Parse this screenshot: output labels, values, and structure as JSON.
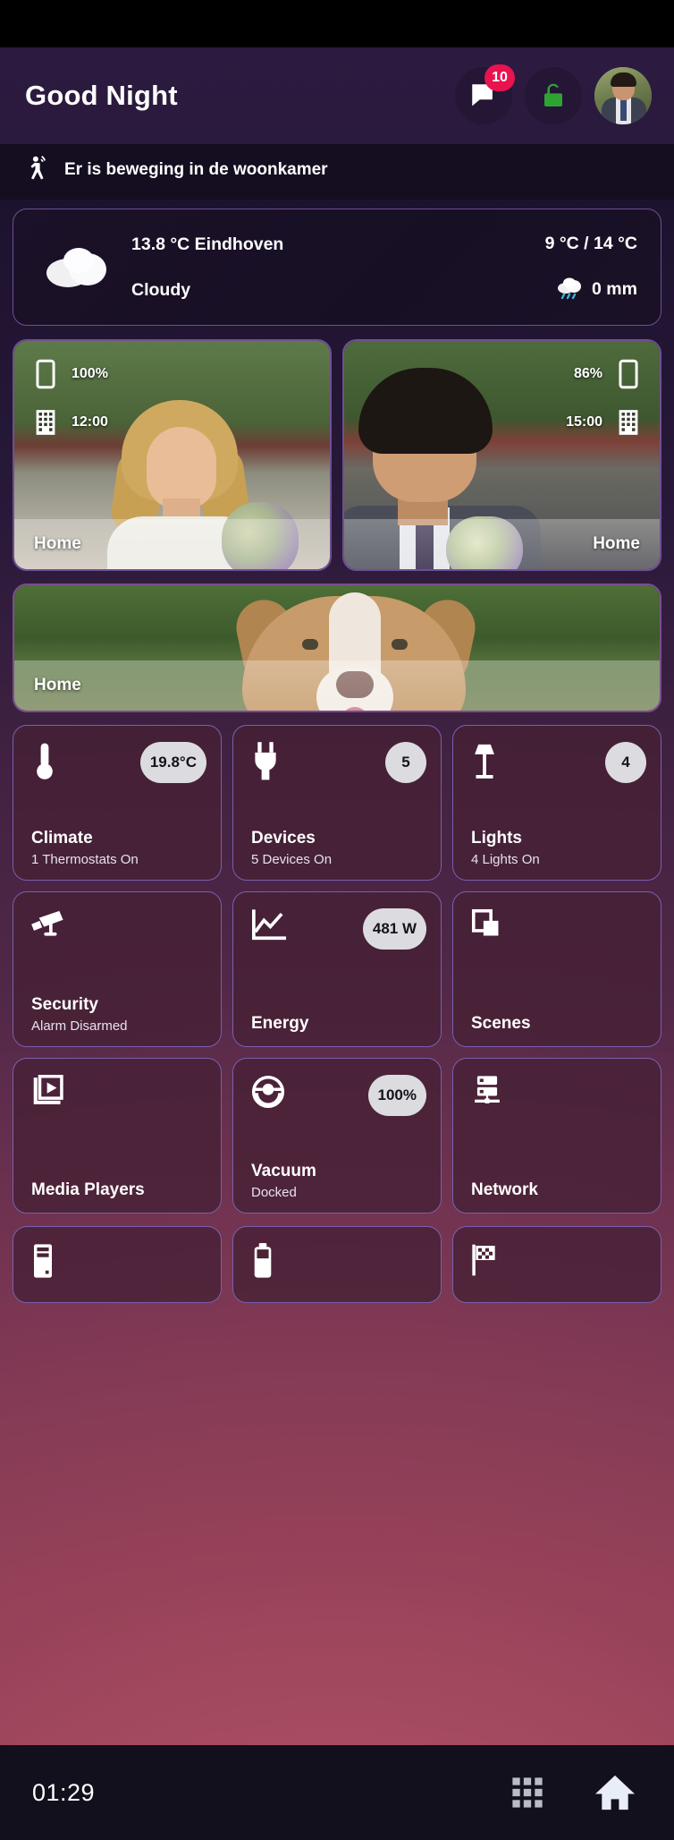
{
  "header": {
    "greeting": "Good Night",
    "notifications_icon": "chat-bubble-icon",
    "notifications_badge": "10",
    "lock_icon": "lock-open-icon",
    "lock_color": "#2ea332",
    "avatar_icon": "user-avatar"
  },
  "notice": {
    "icon": "motion-sensor-icon",
    "text": "Er is beweging in de woonkamer"
  },
  "weather": {
    "icon": "cloudy-icon",
    "temperature_location": "13.8 °C Eindhoven",
    "condition": "Cloudy",
    "range": "9 °C / 14 °C",
    "rain_icon": "rain-cloud-icon",
    "precipitation": "0 mm"
  },
  "people": [
    {
      "name": "Home",
      "battery_icon": "phone-icon",
      "battery": "100%",
      "place_icon": "building-icon",
      "time": "12:00",
      "align": "left"
    },
    {
      "name": "Home",
      "battery_icon": "phone-icon",
      "battery": "86%",
      "place_icon": "building-icon",
      "time": "15:00",
      "align": "right"
    }
  ],
  "pet": {
    "name": "Home"
  },
  "tiles": [
    {
      "icon": "thermometer-icon",
      "pill": "19.8°C",
      "title": "Climate",
      "sub": "1 Thermostats On"
    },
    {
      "icon": "power-plug-icon",
      "pill": "5",
      "title": "Devices",
      "sub": "5 Devices On"
    },
    {
      "icon": "floor-lamp-icon",
      "pill": "4",
      "title": "Lights",
      "sub": "4 Lights On"
    },
    {
      "icon": "cctv-camera-icon",
      "pill": "",
      "title": "Security",
      "sub": "Alarm Disarmed"
    },
    {
      "icon": "line-chart-icon",
      "pill": "481 W",
      "title": "Energy",
      "sub": ""
    },
    {
      "icon": "scenes-layers-icon",
      "pill": "",
      "title": "Scenes",
      "sub": ""
    },
    {
      "icon": "media-player-icon",
      "pill": "",
      "title": "Media Players",
      "sub": ""
    },
    {
      "icon": "robot-vacuum-icon",
      "pill": "100%",
      "title": "Vacuum",
      "sub": "Docked"
    },
    {
      "icon": "server-network-icon",
      "pill": "",
      "title": "Network",
      "sub": ""
    }
  ],
  "tiles_partial": [
    {
      "icon": "server-tower-icon"
    },
    {
      "icon": "battery-icon"
    },
    {
      "icon": "checkered-flag-icon"
    }
  ],
  "bottom_nav": {
    "clock": "01:29",
    "apps_icon": "apps-grid-icon",
    "home_icon": "home-icon"
  },
  "colors": {
    "badge": "#e8134f",
    "lock_green": "#2ea332",
    "pill_bg": "#dcdce0",
    "card_border": "#7b5fb0"
  }
}
